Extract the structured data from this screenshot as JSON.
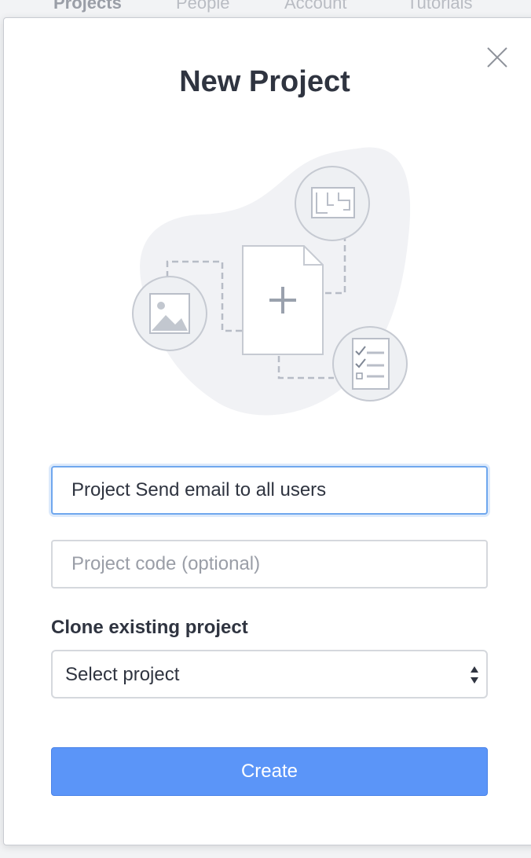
{
  "nav": {
    "items": [
      "Projects",
      "People",
      "Account",
      "Tutorials"
    ]
  },
  "modal": {
    "title": "New Project",
    "close_icon": "close-x-icon",
    "illustration_icons": [
      "image-icon",
      "document-plus-icon",
      "floorplan-icon",
      "checklist-icon"
    ],
    "fields": {
      "name_value": "Project Send email to all users",
      "code_placeholder": "Project code (optional)"
    },
    "clone_label": "Clone existing project",
    "select": {
      "selected": "Select project"
    },
    "create_label": "Create"
  },
  "colors": {
    "primary": "#5b95f8",
    "focus_border": "#6fa7ee",
    "text": "#2f3440",
    "placeholder": "#9a9ea7"
  }
}
